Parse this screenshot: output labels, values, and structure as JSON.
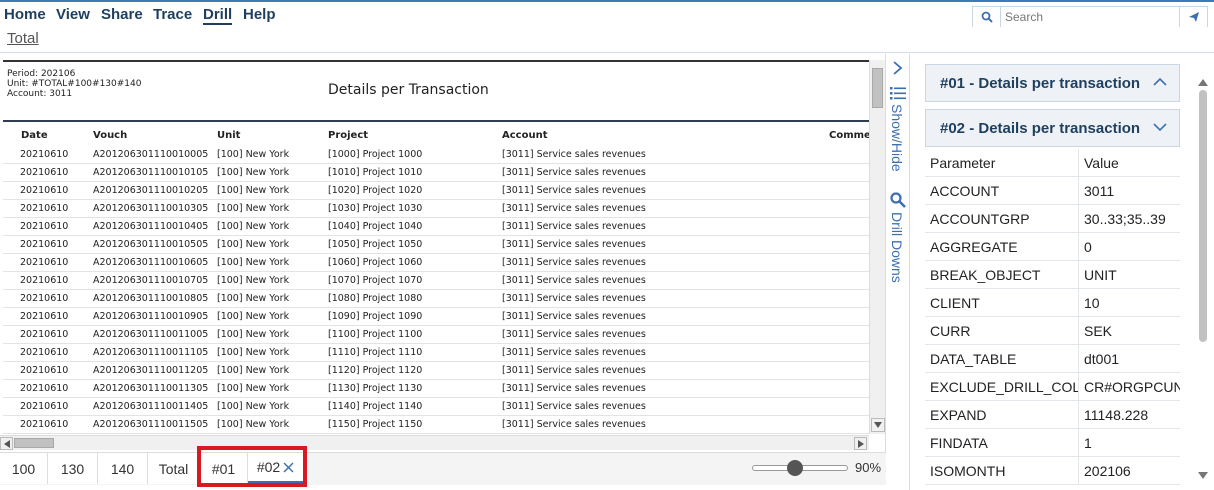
{
  "menu": {
    "items": [
      "Home",
      "View",
      "Share",
      "Trace",
      "Drill",
      "Help"
    ],
    "active": "Drill"
  },
  "search": {
    "placeholder": "Search",
    "icon": "search-icon",
    "send_icon": "send-icon"
  },
  "breadcrumb": {
    "label": "Total"
  },
  "report": {
    "meta": [
      "Period: 202106",
      "Unit: #TOTAL#100#130#140",
      "Account: 3011"
    ],
    "title": "Details per Transaction",
    "columns": [
      "Date",
      "Vouch",
      "Unit",
      "Project",
      "Account",
      "Comme"
    ],
    "rows": [
      [
        "20210610",
        "A201206301110010005",
        "[100] New York",
        "[1000] Project 1000",
        "[3011] Service sales revenues"
      ],
      [
        "20210610",
        "A201206301110010105",
        "[100] New York",
        "[1010] Project 1010",
        "[3011] Service sales revenues"
      ],
      [
        "20210610",
        "A201206301110010205",
        "[100] New York",
        "[1020] Project 1020",
        "[3011] Service sales revenues"
      ],
      [
        "20210610",
        "A201206301110010305",
        "[100] New York",
        "[1030] Project 1030",
        "[3011] Service sales revenues"
      ],
      [
        "20210610",
        "A201206301110010405",
        "[100] New York",
        "[1040] Project 1040",
        "[3011] Service sales revenues"
      ],
      [
        "20210610",
        "A201206301110010505",
        "[100] New York",
        "[1050] Project 1050",
        "[3011] Service sales revenues"
      ],
      [
        "20210610",
        "A201206301110010605",
        "[100] New York",
        "[1060] Project 1060",
        "[3011] Service sales revenues"
      ],
      [
        "20210610",
        "A201206301110010705",
        "[100] New York",
        "[1070] Project 1070",
        "[3011] Service sales revenues"
      ],
      [
        "20210610",
        "A201206301110010805",
        "[100] New York",
        "[1080] Project 1080",
        "[3011] Service sales revenues"
      ],
      [
        "20210610",
        "A201206301110010905",
        "[100] New York",
        "[1090] Project 1090",
        "[3011] Service sales revenues"
      ],
      [
        "20210610",
        "A201206301110011005",
        "[100] New York",
        "[1100] Project 1100",
        "[3011] Service sales revenues"
      ],
      [
        "20210610",
        "A201206301110011105",
        "[100] New York",
        "[1110] Project 1110",
        "[3011] Service sales revenues"
      ],
      [
        "20210610",
        "A201206301110011205",
        "[100] New York",
        "[1120] Project 1120",
        "[3011] Service sales revenues"
      ],
      [
        "20210610",
        "A201206301110011305",
        "[100] New York",
        "[1130] Project 1130",
        "[3011] Service sales revenues"
      ],
      [
        "20210610",
        "A201206301110011405",
        "[100] New York",
        "[1140] Project 1140",
        "[3011] Service sales revenues"
      ],
      [
        "20210610",
        "A201206301110011505",
        "[100] New York",
        "[1150] Project 1150",
        "[3011] Service sales revenues"
      ]
    ]
  },
  "tabs": [
    {
      "label": "100"
    },
    {
      "label": "130"
    },
    {
      "label": "140"
    },
    {
      "label": "Total"
    },
    {
      "label": "#01"
    },
    {
      "label": "#02",
      "closable": true,
      "active": true
    }
  ],
  "zoom": {
    "label": "90%",
    "level": 0.45
  },
  "side_strip": {
    "show_hide": "Show/Hide",
    "drill_downs": "Drill Downs"
  },
  "panel": {
    "sections": [
      {
        "title": "#01 - Details per transaction",
        "expanded": true
      },
      {
        "title": "#02 - Details per transaction",
        "expanded": false
      }
    ],
    "table_headers": [
      "Parameter",
      "Value"
    ],
    "params": [
      [
        "ACCOUNT",
        "3011"
      ],
      [
        "ACCOUNTGRP",
        "30..33;35..39"
      ],
      [
        "AGGREGATE",
        "0"
      ],
      [
        "BREAK_OBJECT",
        "UNIT"
      ],
      [
        "CLIENT",
        "10"
      ],
      [
        "CURR",
        "SEK"
      ],
      [
        "DATA_TABLE",
        "dt001"
      ],
      [
        "EXCLUDE_DRILL_COL",
        "CR#ORGPCUN"
      ],
      [
        "EXPAND",
        "11148.228"
      ],
      [
        "FINDATA",
        "1"
      ],
      [
        "ISOMONTH",
        "202106"
      ]
    ]
  },
  "colors": {
    "accent": "#3d6fb0",
    "highlight": "#d9181f",
    "menu_text": "#1f3f5f"
  }
}
